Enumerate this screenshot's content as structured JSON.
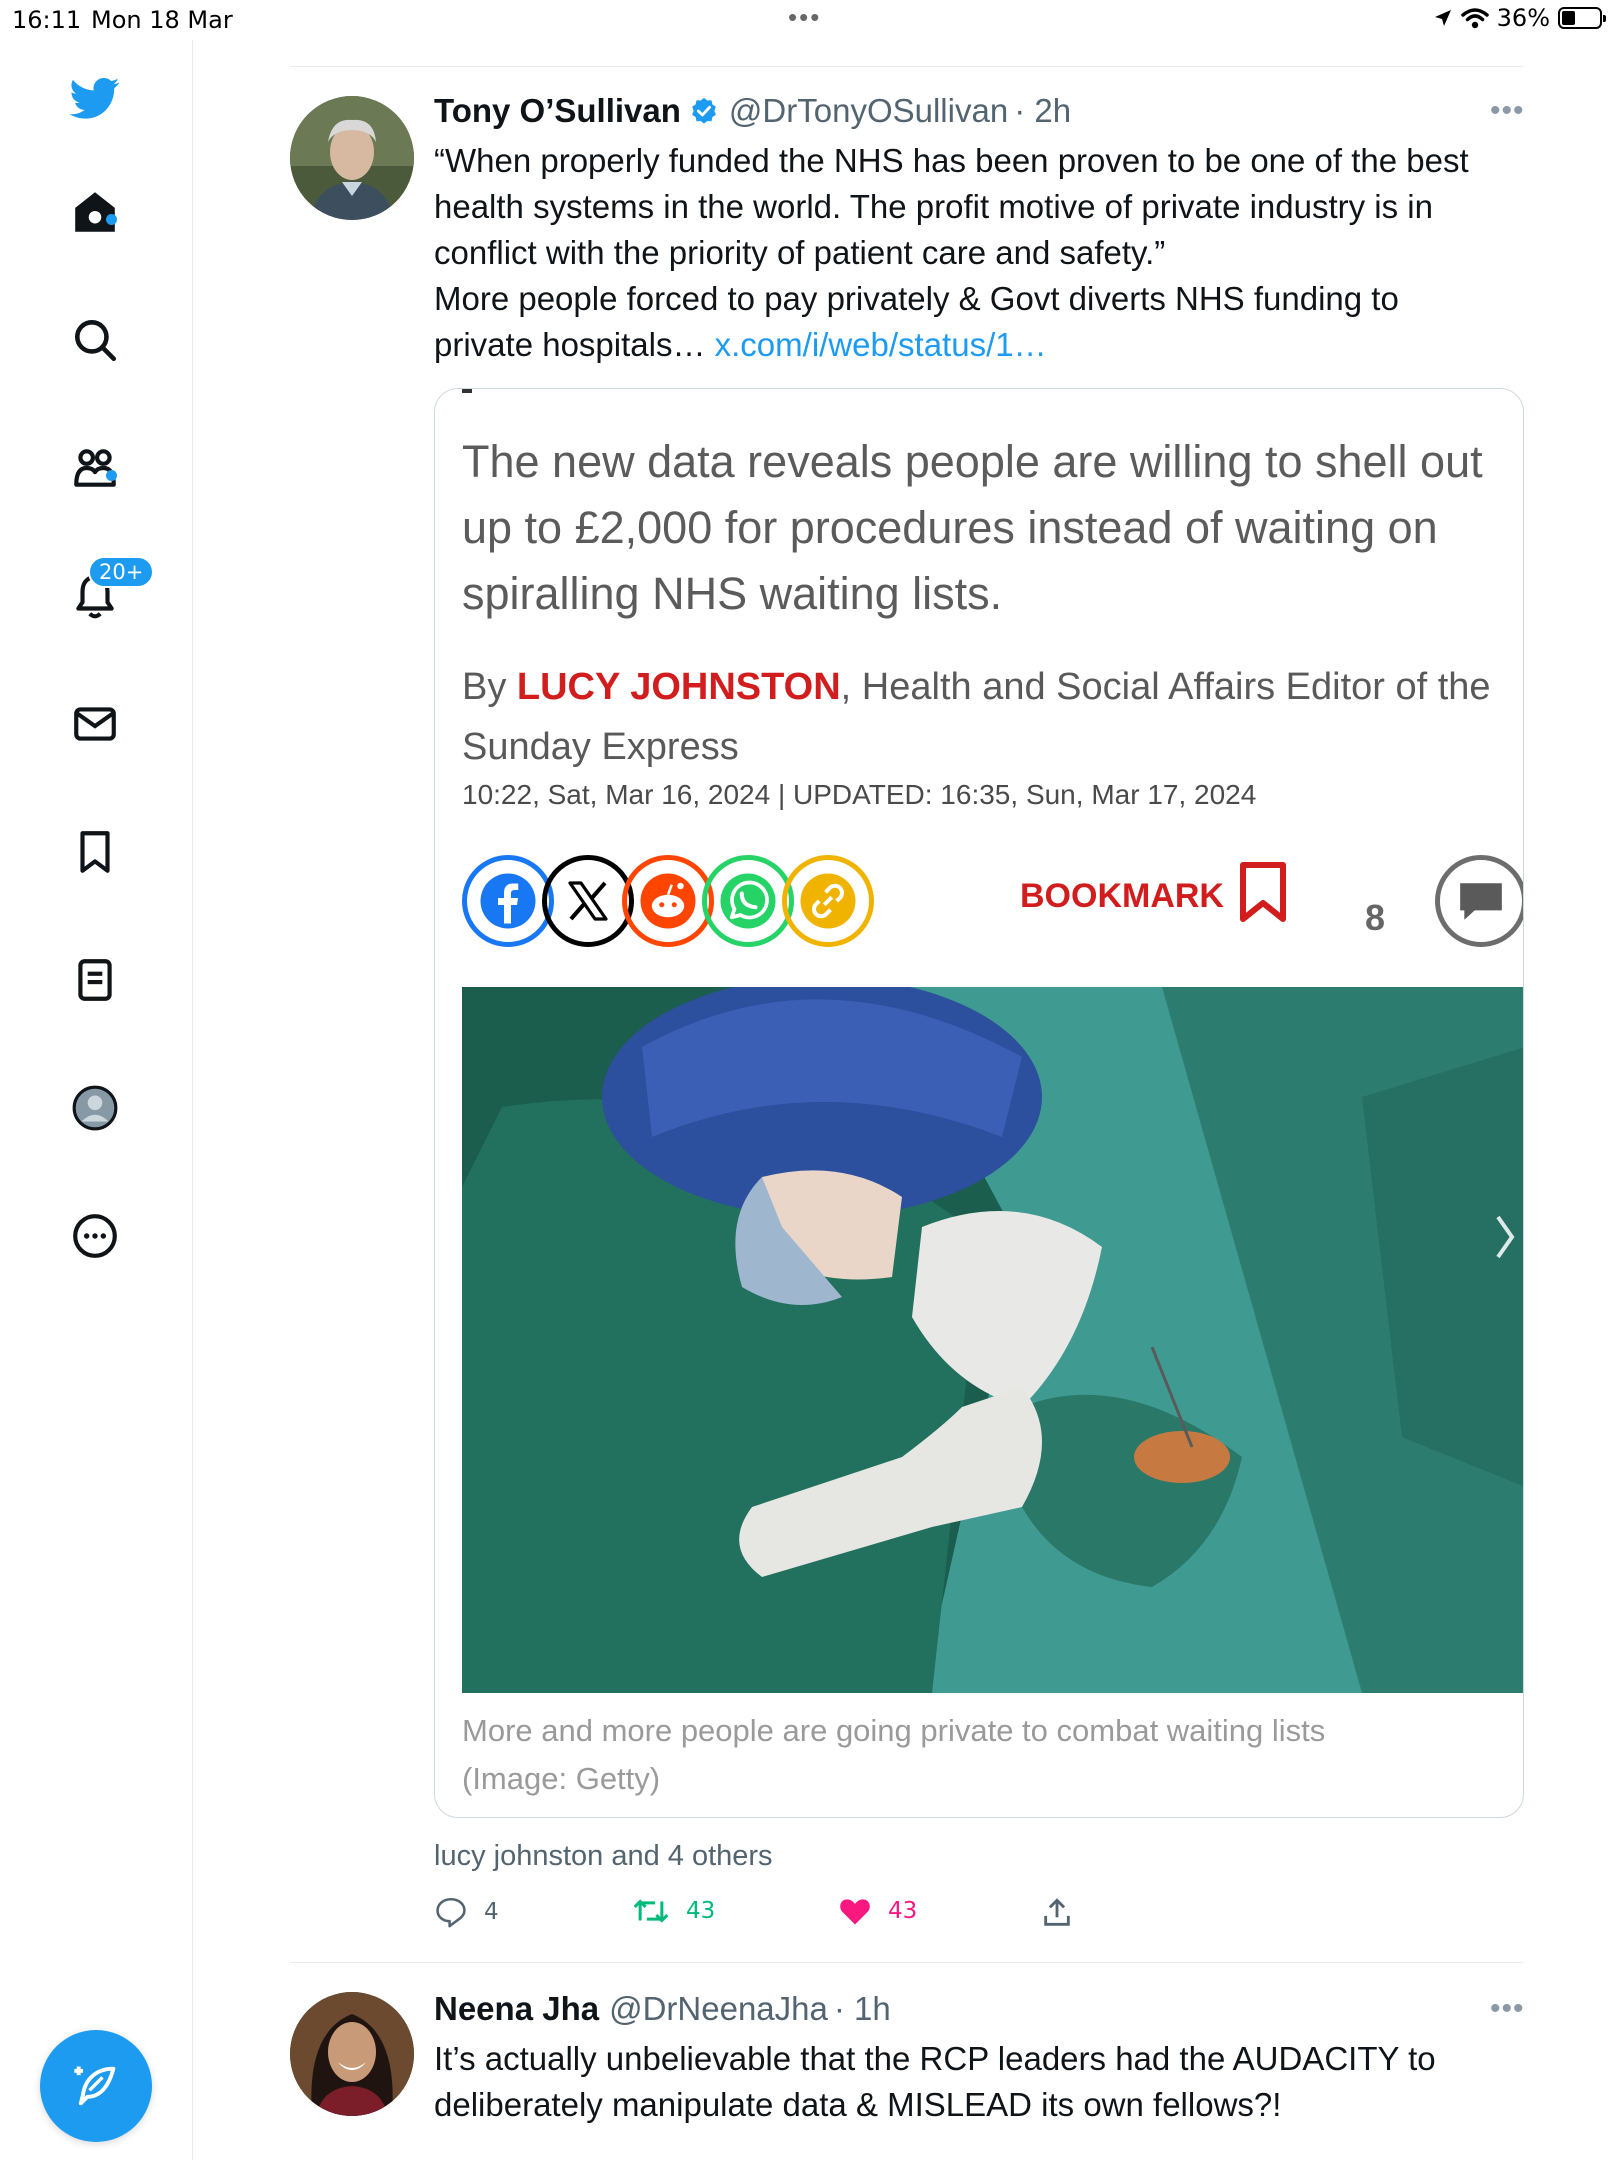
{
  "status_bar": {
    "time": "16:11",
    "date": "Mon 18 Mar",
    "battery": "36%",
    "battery_level": 0.36
  },
  "sidebar": {
    "notifications_badge": "20+"
  },
  "tweet1": {
    "name": "Tony O’Sullivan",
    "handle": "@DrTonyOSullivan",
    "time": "· 2h",
    "text_lines": [
      "“When properly funded the NHS has been proven to be one of the best",
      "health systems in the world. The profit motive of private industry is in",
      "conflict with the priority of patient care and safety.”",
      "More people forced to pay privately & Govt diverts NHS funding to",
      "private hospitals… "
    ],
    "link": "x.com/i/web/status/1…",
    "card": {
      "headline_lines": [
        "The new data reveals people are willing to shell out",
        "up to £2,000 for procedures instead of waiting on",
        "spiralling NHS waiting lists."
      ],
      "by_prefix": "By ",
      "author": "LUCY JOHNSTON",
      "by_suffix": ", Health and Social Affairs Editor of the",
      "publication": "Sunday Express",
      "dateline": "10:22, Sat, Mar 16, 2024 | UPDATED: 16:35, Sun, Mar 17, 2024",
      "bookmark_label": "BOOKMARK",
      "comment_count": "8",
      "caption_lines": [
        "More and more people are going private to combat waiting lists",
        "(Image: Getty)"
      ]
    },
    "liked_by": "lucy johnston and 4 others",
    "replies": "4",
    "retweets": "43",
    "likes": "43"
  },
  "tweet2": {
    "name": "Neena Jha",
    "handle": "@DrNeenaJha",
    "time": "· 1h",
    "text_lines": [
      "It’s actually unbelievable that the RCP leaders had the AUDACITY to",
      "deliberately manipulate data & MISLEAD its own fellows?!"
    ]
  },
  "colors": {
    "twitter_blue": "#1d9bf0",
    "retweet_green": "#00ba7c",
    "like_pink": "#f91880",
    "express_red": "#d11d1d"
  },
  "icons": [
    "twitter-bird-icon",
    "home-icon",
    "search-icon",
    "communities-icon",
    "notifications-bell-icon",
    "messages-icon",
    "bookmarks-icon",
    "lists-icon",
    "profile-icon",
    "more-circle-icon",
    "compose-feather-icon",
    "verified-badge-icon",
    "reply-icon",
    "retweet-icon",
    "heart-icon",
    "share-icon"
  ]
}
